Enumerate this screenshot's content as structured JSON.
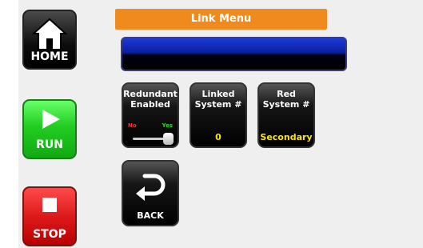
{
  "side_nav": {
    "home": {
      "label": "HOME",
      "icon": "home-icon"
    },
    "run": {
      "label": "RUN",
      "icon": "play-icon"
    },
    "stop": {
      "label": "STOP",
      "icon": "stop-icon"
    }
  },
  "header": {
    "title": "Link Menu"
  },
  "display": {
    "value": ""
  },
  "tiles": [
    {
      "title_line1": "Redundant",
      "title_line2": "Enabled",
      "toggle_off": "No",
      "toggle_on": "Yes",
      "toggle_state": "Yes"
    },
    {
      "title_line1": "Linked",
      "title_line2": "System #",
      "value": "0"
    },
    {
      "title_line1": "Red",
      "title_line2": "System #",
      "value": "Secondary"
    }
  ],
  "back": {
    "label": "BACK",
    "icon": "back-arrow-icon"
  },
  "colors": {
    "header": "#f08a1e",
    "run": "#22cc22",
    "stop": "#dd1a1a",
    "value_text": "#ffe400"
  }
}
